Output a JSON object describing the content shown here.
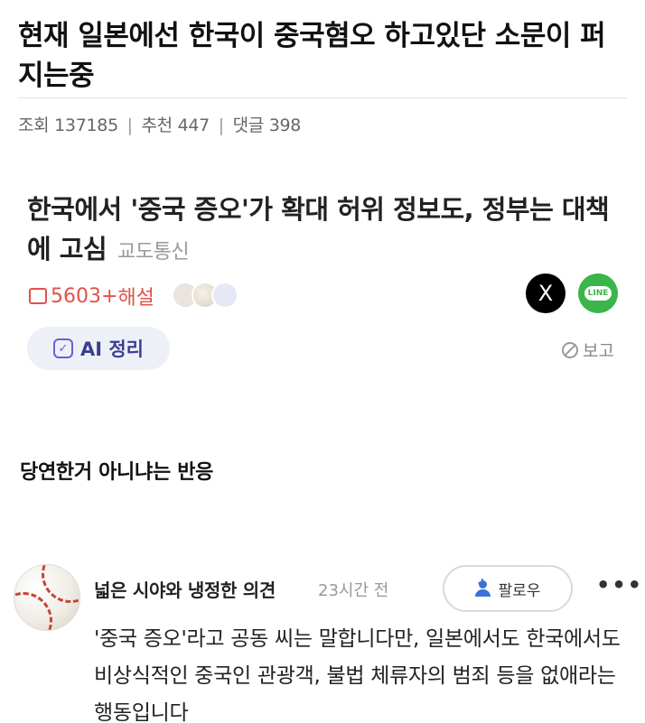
{
  "post": {
    "title": "현재 일본에선 한국이 중국혐오 하고있단 소문이 퍼지는중",
    "views_label": "조회",
    "views": "137185",
    "recommend_label": "추천",
    "recommend": "447",
    "comments_label": "댓글",
    "comments": "398"
  },
  "article": {
    "headline": "한국에서 '중국 증오'가 확대 허위 정보도, 정부는 대책에 고심",
    "source": "교도통신",
    "comment_count": "5603",
    "plus_label": "+",
    "commentary_label": "해설",
    "share_x_label": "X",
    "share_line_label": "LINE",
    "ai_button_label": "AI 정리",
    "report_label": "보고"
  },
  "caption": "당연한거 아니냐는 반응",
  "comment": {
    "author": "넓은 시야와 냉정한 의견",
    "time": "23시간 전",
    "follow_label": "팔로우",
    "more_label": "•••",
    "body": "'중국 증오'라고 공동 씨는 말합니다만, 일본에서도 한국에서도 비상식적인 중국인 관광객, 불법 체류자의 범죄 등을 없애라는 행동입니다"
  },
  "colors": {
    "comment_count": "#e0524a",
    "line_green": "#39b54a",
    "follow_blue": "#3a72d9",
    "ai_purple": "#6b5fd6"
  }
}
